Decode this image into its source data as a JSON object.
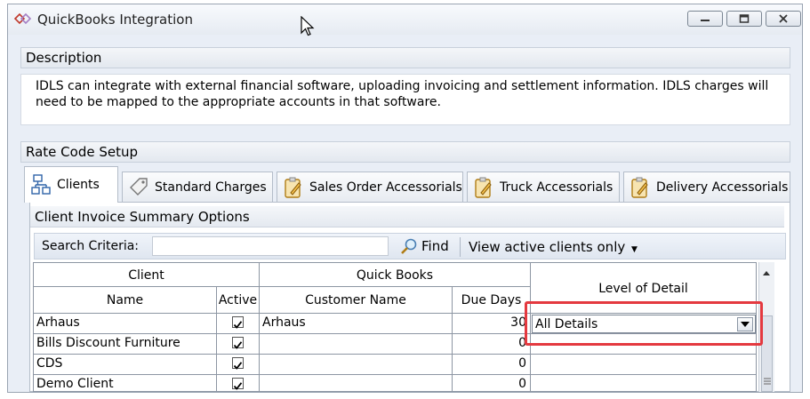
{
  "window": {
    "title": "QuickBooks Integration",
    "controls": [
      "minimize",
      "maximize",
      "close"
    ]
  },
  "description": {
    "header": "Description",
    "text": "IDLS can integrate with external financial software, uploading invoicing and settlement  information.  IDLS charges will need to be mapped to the appropriate accounts in that software."
  },
  "rate_code": {
    "header": "Rate Code Setup",
    "tabs": [
      {
        "label": "Clients",
        "icon": "clients-network-icon",
        "active": true
      },
      {
        "label": "Standard Charges",
        "icon": "tag-icon",
        "active": false
      },
      {
        "label": "Sales Order Accessorials",
        "icon": "clipboard-icon",
        "active": false
      },
      {
        "label": "Truck Accessorials",
        "icon": "clipboard-icon",
        "active": false
      },
      {
        "label": "Delivery Accessorials",
        "icon": "clipboard-icon",
        "active": false
      }
    ]
  },
  "client_summary": {
    "header": "Client Invoice Summary Options",
    "search_label": "Search Criteria:",
    "search_value": "",
    "find_label": "Find",
    "filter_label": "View active clients only"
  },
  "grid": {
    "group_headers": {
      "client": "Client",
      "quickbooks": "Quick Books"
    },
    "columns": {
      "name": "Name",
      "active": "Active",
      "customer_name": "Customer Name",
      "due_days": "Due Days",
      "level": "Level of Detail"
    },
    "rows": [
      {
        "name": "Arhaus",
        "active": true,
        "customer_name": "Arhaus",
        "due_days": "30",
        "level": "All Details"
      },
      {
        "name": "Bills Discount Furniture",
        "active": true,
        "customer_name": "",
        "due_days": "0",
        "level": ""
      },
      {
        "name": "CDS",
        "active": true,
        "customer_name": "",
        "due_days": "0",
        "level": ""
      },
      {
        "name": "Demo Client",
        "active": true,
        "customer_name": "",
        "due_days": "0",
        "level": ""
      }
    ]
  },
  "colors": {
    "highlight": "#e4393f",
    "accent": "#c0392b"
  }
}
